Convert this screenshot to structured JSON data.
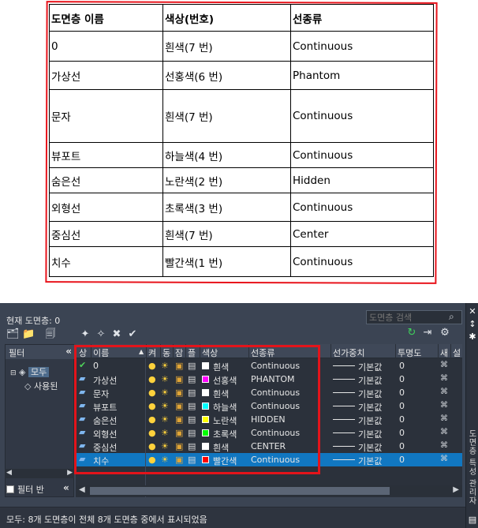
{
  "doc_table": {
    "header": [
      "도면층 이름",
      "색상(번호)",
      "선종류"
    ],
    "rows": [
      [
        "0",
        "흰색(7 번)",
        "Continuous"
      ],
      [
        "가상선",
        "선홍색(6 번)",
        "Phantom"
      ],
      [
        "문자",
        "흰색(7 번)",
        "Continuous"
      ],
      [
        "뷰포트",
        "하늘색(4 번)",
        "Continuous"
      ],
      [
        "숨은선",
        "노란색(2 번)",
        "Hidden"
      ],
      [
        "외형선",
        "초록색(3 번)",
        "Continuous"
      ],
      [
        "중심선",
        "흰색(7 번)",
        "Center"
      ],
      [
        "치수",
        "빨간색(1 번)",
        "Continuous"
      ]
    ]
  },
  "layer_manager": {
    "current_layer": "현재 도면층: 0",
    "search_placeholder": "도면층 검색",
    "palette_title": "도면층 특성 관리자",
    "filter_header": "필터",
    "filter_collapse": "«",
    "tree_all": "모두",
    "tree_used": "사용된",
    "filter_invert": "필터 반",
    "columns": [
      "상",
      "이름",
      "켜",
      "동",
      "잠",
      "플",
      "색상",
      "선종류",
      "선가중치",
      "투명도",
      "새",
      "설"
    ],
    "layers": [
      {
        "name": "0",
        "color_name": "흰색",
        "color": "#ffffff",
        "linetype": "Continuous",
        "lineweight": "기본값",
        "transparency": "0",
        "current": true,
        "selected": false
      },
      {
        "name": "가상선",
        "color_name": "선홍색",
        "color": "#ff00ff",
        "linetype": "PHANTOM",
        "lineweight": "기본값",
        "transparency": "0",
        "current": false,
        "selected": false
      },
      {
        "name": "문자",
        "color_name": "흰색",
        "color": "#ffffff",
        "linetype": "Continuous",
        "lineweight": "기본값",
        "transparency": "0",
        "current": false,
        "selected": false
      },
      {
        "name": "뷰포트",
        "color_name": "하늘색",
        "color": "#00ffff",
        "linetype": "Continuous",
        "lineweight": "기본값",
        "transparency": "0",
        "current": false,
        "selected": false
      },
      {
        "name": "숨은선",
        "color_name": "노란색",
        "color": "#ffff00",
        "linetype": "HIDDEN",
        "lineweight": "기본값",
        "transparency": "0",
        "current": false,
        "selected": false
      },
      {
        "name": "외형선",
        "color_name": "초록색",
        "color": "#00ff00",
        "linetype": "Continuous",
        "lineweight": "기본값",
        "transparency": "0",
        "current": false,
        "selected": false
      },
      {
        "name": "중심선",
        "color_name": "흰색",
        "color": "#ffffff",
        "linetype": "CENTER",
        "lineweight": "기본값",
        "transparency": "0",
        "current": false,
        "selected": false
      },
      {
        "name": "치수",
        "color_name": "빨간색",
        "color": "#ff0000",
        "linetype": "Continuous",
        "lineweight": "기본값",
        "transparency": "0",
        "current": false,
        "selected": true
      }
    ],
    "status_text": "모두: 8개 도면층이 전체 8개 도면층 중에서 표시되었음",
    "icons": {
      "current": "check-icon",
      "layer": "layer-icon",
      "on": "bulb-icon",
      "freeze": "sun-icon",
      "lock": "lock-icon",
      "plot": "printer-icon",
      "viewport": "viewport-freeze-icon"
    }
  }
}
